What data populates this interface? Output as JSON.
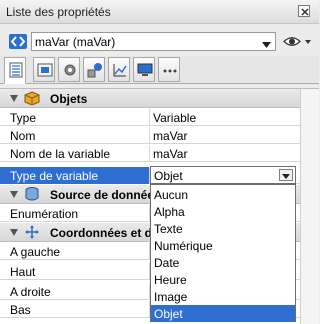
{
  "window": {
    "title": "Liste des propriétés"
  },
  "variable_selector": {
    "value": "maVar (maVar)"
  },
  "tabs": [
    "properties",
    "form",
    "settings",
    "shapes",
    "chart",
    "monitor",
    "more"
  ],
  "sections": [
    {
      "title": "Objets"
    },
    {
      "title": "Source de données"
    },
    {
      "title": "Coordonnées et dimensions"
    }
  ],
  "properties": [
    {
      "key": "Type",
      "value": "Variable"
    },
    {
      "key": "Nom",
      "value": "maVar"
    },
    {
      "key": "Nom de la variable",
      "value": "maVar"
    },
    {
      "key": "Type de variable",
      "value": "Objet"
    }
  ],
  "datasource": [
    {
      "key": "Enumération",
      "value": ""
    }
  ],
  "coords": [
    {
      "key": "A gauche"
    },
    {
      "key": "Haut"
    },
    {
      "key": "A droite"
    },
    {
      "key": "Bas"
    }
  ],
  "dropdown": {
    "selected": "Objet",
    "options": [
      "Aucun",
      "Alpha",
      "Texte",
      "Numérique",
      "Date",
      "Heure",
      "Image",
      "Objet"
    ]
  },
  "colors": {
    "selection": "#2e6ed1",
    "accent_icon": "#2a6fcf"
  }
}
